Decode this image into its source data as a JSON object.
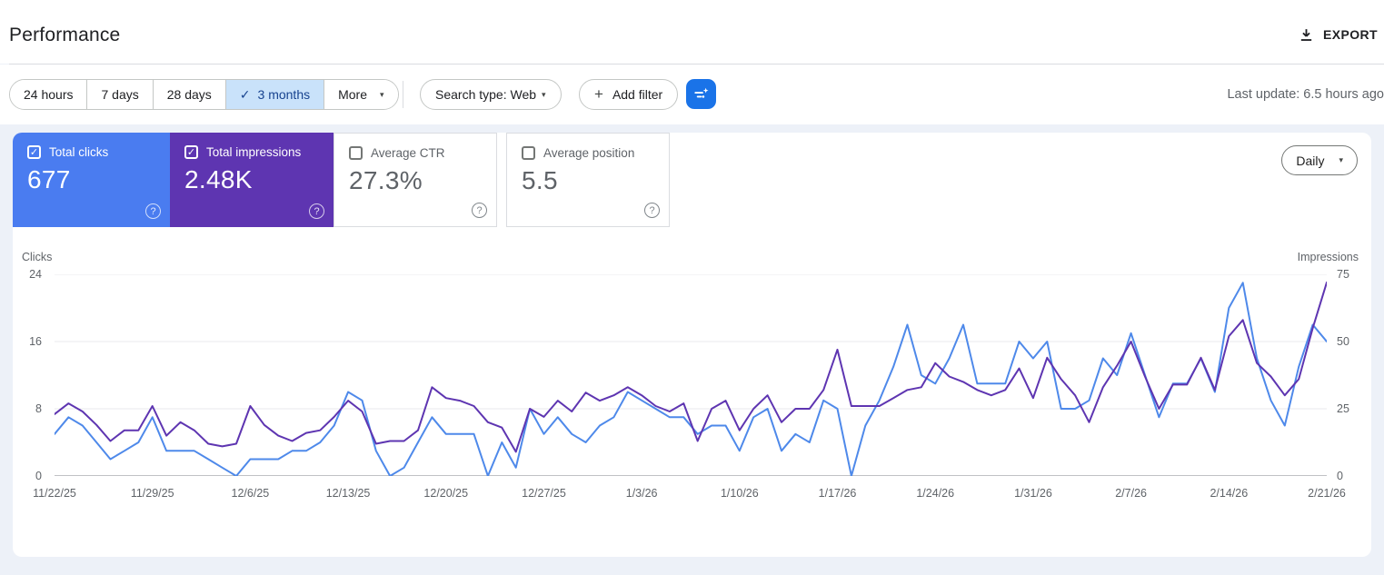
{
  "page": {
    "title": "Performance",
    "export_label": "EXPORT",
    "last_update": "Last update: 6.5 hours ago"
  },
  "icons": {
    "check": "✓",
    "caret_down": "▾",
    "plus": "+",
    "help": "?",
    "checkbox_check": "✓"
  },
  "filters": {
    "date_ranges": [
      {
        "label": "24 hours",
        "selected": false
      },
      {
        "label": "7 days",
        "selected": false
      },
      {
        "label": "28 days",
        "selected": false
      },
      {
        "label": "3 months",
        "selected": true
      }
    ],
    "more_label": "More",
    "search_type_label": "Search type: Web",
    "add_filter_label": "Add filter",
    "selected_chip_bg": "#c9e2fa",
    "sparkle_button_color": "#1a73e8"
  },
  "metrics": [
    {
      "label": "Total clicks",
      "value": "677",
      "checked": true,
      "color": "#4a7cf0"
    },
    {
      "label": "Total impressions",
      "value": "2.48K",
      "checked": true,
      "color": "#5e35b1"
    },
    {
      "label": "Average CTR",
      "value": "27.3%",
      "checked": false,
      "color": "#ffffff"
    },
    {
      "label": "Average position",
      "value": "5.5",
      "checked": false,
      "color": "#ffffff"
    }
  ],
  "granularity": {
    "label": "Daily"
  },
  "chart_data": {
    "type": "line",
    "title": "",
    "x_tick_days": [
      0,
      7,
      14,
      21,
      28,
      35,
      42,
      49,
      56,
      63,
      70,
      77,
      84,
      91
    ],
    "x_tick_labels": [
      "11/22/25",
      "11/29/25",
      "12/6/25",
      "12/13/25",
      "12/20/25",
      "12/27/25",
      "1/3/26",
      "1/10/26",
      "1/17/26",
      "1/24/26",
      "1/31/26",
      "2/7/26",
      "2/14/26",
      "2/21/26"
    ],
    "x": [
      "11/22/25",
      "11/23/25",
      "11/24/25",
      "11/25/25",
      "11/26/25",
      "11/27/25",
      "11/28/25",
      "11/29/25",
      "11/30/25",
      "12/1/25",
      "12/2/25",
      "12/3/25",
      "12/4/25",
      "12/5/25",
      "12/6/25",
      "12/7/25",
      "12/8/25",
      "12/9/25",
      "12/10/25",
      "12/11/25",
      "12/12/25",
      "12/13/25",
      "12/14/25",
      "12/15/25",
      "12/16/25",
      "12/17/25",
      "12/18/25",
      "12/19/25",
      "12/20/25",
      "12/21/25",
      "12/22/25",
      "12/23/25",
      "12/24/25",
      "12/25/25",
      "12/26/25",
      "12/27/25",
      "12/28/25",
      "12/29/25",
      "12/30/25",
      "12/31/25",
      "1/1/26",
      "1/2/26",
      "1/3/26",
      "1/4/26",
      "1/5/26",
      "1/6/26",
      "1/7/26",
      "1/8/26",
      "1/9/26",
      "1/10/26",
      "1/11/26",
      "1/12/26",
      "1/13/26",
      "1/14/26",
      "1/15/26",
      "1/16/26",
      "1/17/26",
      "1/18/26",
      "1/19/26",
      "1/20/26",
      "1/21/26",
      "1/22/26",
      "1/23/26",
      "1/24/26",
      "1/25/26",
      "1/26/26",
      "1/27/26",
      "1/28/26",
      "1/29/26",
      "1/30/26",
      "1/31/26",
      "2/1/26",
      "2/2/26",
      "2/3/26",
      "2/4/26",
      "2/5/26",
      "2/6/26",
      "2/7/26",
      "2/8/26",
      "2/9/26",
      "2/10/26",
      "2/11/26",
      "2/12/26",
      "2/13/26",
      "2/14/26",
      "2/15/26",
      "2/16/26",
      "2/17/26",
      "2/18/26",
      "2/19/26",
      "2/20/26",
      "2/21/26"
    ],
    "series": [
      {
        "name": "Clicks",
        "axis": "left",
        "color": "#4e89ea",
        "values": [
          5,
          7,
          6,
          4,
          2,
          3,
          4,
          7,
          3,
          3,
          3,
          2,
          1,
          0,
          2,
          2,
          2,
          3,
          3,
          4,
          6,
          10,
          9,
          3,
          0,
          1,
          4,
          7,
          5,
          5,
          5,
          0,
          4,
          1,
          8,
          5,
          7,
          5,
          4,
          6,
          7,
          10,
          9,
          8,
          7,
          7,
          5,
          6,
          6,
          3,
          7,
          8,
          3,
          5,
          4,
          9,
          8,
          0,
          6,
          9,
          13,
          18,
          12,
          11,
          14,
          18,
          11,
          11,
          11,
          16,
          14,
          16,
          8,
          8,
          9,
          14,
          12,
          17,
          12,
          7,
          11,
          11,
          14,
          10,
          20,
          23,
          14,
          9,
          6,
          13,
          18,
          16
        ]
      },
      {
        "name": "Impressions",
        "axis": "right",
        "color": "#5e35b1",
        "values": [
          23,
          27,
          24,
          19,
          13,
          17,
          17,
          26,
          15,
          20,
          17,
          12,
          11,
          12,
          26,
          19,
          15,
          13,
          16,
          17,
          22,
          28,
          24,
          12,
          13,
          13,
          17,
          33,
          29,
          28,
          26,
          20,
          18,
          9,
          25,
          22,
          28,
          24,
          31,
          28,
          30,
          33,
          30,
          26,
          24,
          27,
          13,
          25,
          28,
          17,
          25,
          30,
          20,
          25,
          25,
          32,
          47,
          26,
          26,
          26,
          29,
          32,
          33,
          42,
          37,
          35,
          32,
          30,
          32,
          40,
          29,
          44,
          36,
          30,
          20,
          33,
          41,
          50,
          37,
          25,
          34,
          34,
          44,
          32,
          52,
          58,
          42,
          37,
          30,
          36,
          55,
          72
        ]
      }
    ],
    "left_axis": {
      "label": "Clicks",
      "max": 24,
      "ticks": [
        24,
        16,
        8,
        0
      ]
    },
    "right_axis": {
      "label": "Impressions",
      "max": 75,
      "ticks": [
        75,
        50,
        25,
        0
      ]
    },
    "grid_color": "#e8eaed",
    "baseline_color": "#80868b",
    "legend_position": "none"
  }
}
